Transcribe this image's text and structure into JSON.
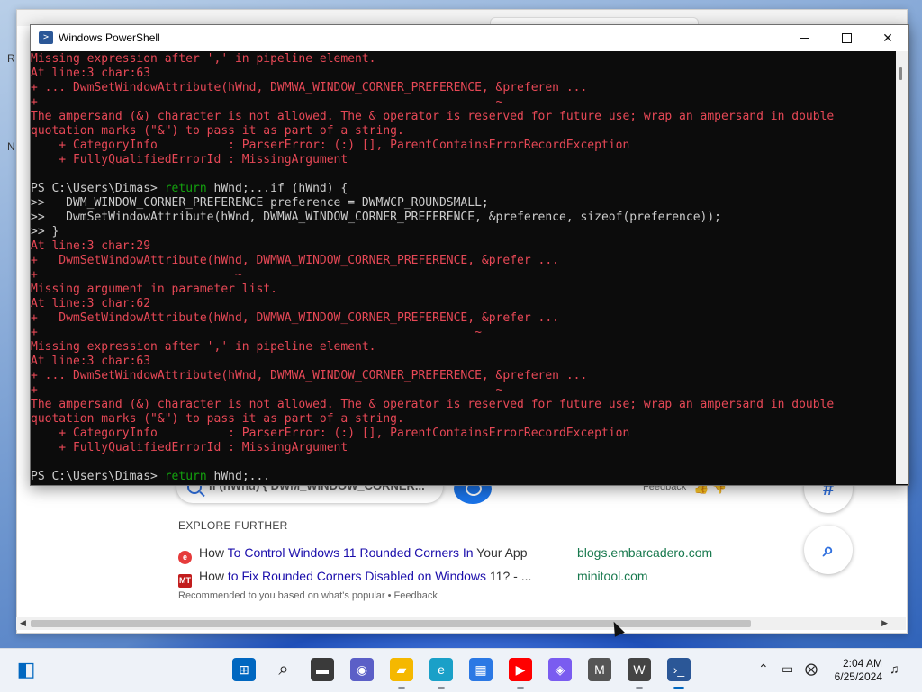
{
  "desktop": {
    "left_strip_letters": [
      "R",
      "N"
    ]
  },
  "browser": {
    "search_query": "if (hWnd) {   DWM_WINDOW_CORNER...",
    "feedback_label": "Feedback",
    "side_buttons": [
      {
        "glyph": "#"
      },
      {
        "glyph": "⌕"
      }
    ],
    "explore_title": "EXPLORE FURTHER",
    "results": [
      {
        "favicon_text": "e",
        "favicon_color": "#e63b3b",
        "pre": "How ",
        "link": "To Control Windows 11 Rounded Corners In",
        "post": " Your App",
        "source": "blogs.embarcadero.com"
      },
      {
        "favicon_text": "MT",
        "favicon_color": "#c21d1d",
        "pre": "How ",
        "link": "to Fix Rounded Corners Disabled on Windows",
        "post": " 11? - ...",
        "source": "minitool.com"
      }
    ],
    "recommended_text": "Recommended to you based on what's popular • Feedback"
  },
  "powershell": {
    "title": "Windows PowerShell",
    "lines": [
      {
        "cls": "err",
        "text": "Missing expression after ',' in pipeline element."
      },
      {
        "cls": "err",
        "text": "At line:3 char:63"
      },
      {
        "cls": "err",
        "text": "+ ... DwmSetWindowAttribute(hWnd, DWMWA_WINDOW_CORNER_PREFERENCE, &preferen ..."
      },
      {
        "cls": "err",
        "text": "+                                                                 ~"
      },
      {
        "cls": "err",
        "text": "The ampersand (&) character is not allowed. The & operator is reserved for future use; wrap an ampersand in double"
      },
      {
        "cls": "err",
        "text": "quotation marks (\"&\") to pass it as part of a string."
      },
      {
        "cls": "err",
        "text": "    + CategoryInfo          : ParserError: (:) [], ParentContainsErrorRecordException"
      },
      {
        "cls": "err",
        "text": "    + FullyQualifiedErrorId : MissingArgument"
      },
      {
        "cls": "",
        "text": " "
      },
      {
        "cls": "",
        "prompt": "PS C:\\Users\\Dimas> ",
        "kw": "return",
        "text": " hWnd;...if (hWnd) {"
      },
      {
        "cls": "",
        "text": ">>   DWM_WINDOW_CORNER_PREFERENCE preference = DWMWCP_ROUNDSMALL;"
      },
      {
        "cls": "",
        "text": ">>   DwmSetWindowAttribute(hWnd, DWMWA_WINDOW_CORNER_PREFERENCE, &preference, sizeof(preference));"
      },
      {
        "cls": "",
        "text": ">> }"
      },
      {
        "cls": "err",
        "text": "At line:3 char:29"
      },
      {
        "cls": "err",
        "text": "+   DwmSetWindowAttribute(hWnd, DWMWA_WINDOW_CORNER_PREFERENCE, &prefer ..."
      },
      {
        "cls": "err",
        "text": "+                            ~"
      },
      {
        "cls": "err",
        "text": "Missing argument in parameter list."
      },
      {
        "cls": "err",
        "text": "At line:3 char:62"
      },
      {
        "cls": "err",
        "text": "+   DwmSetWindowAttribute(hWnd, DWMWA_WINDOW_CORNER_PREFERENCE, &prefer ..."
      },
      {
        "cls": "err",
        "text": "+                                                              ~"
      },
      {
        "cls": "err",
        "text": "Missing expression after ',' in pipeline element."
      },
      {
        "cls": "err",
        "text": "At line:3 char:63"
      },
      {
        "cls": "err",
        "text": "+ ... DwmSetWindowAttribute(hWnd, DWMWA_WINDOW_CORNER_PREFERENCE, &preferen ..."
      },
      {
        "cls": "err",
        "text": "+                                                                 ~"
      },
      {
        "cls": "err",
        "text": "The ampersand (&) character is not allowed. The & operator is reserved for future use; wrap an ampersand in double"
      },
      {
        "cls": "err",
        "text": "quotation marks (\"&\") to pass it as part of a string."
      },
      {
        "cls": "err",
        "text": "    + CategoryInfo          : ParserError: (:) [], ParentContainsErrorRecordException"
      },
      {
        "cls": "err",
        "text": "    + FullyQualifiedErrorId : MissingArgument"
      },
      {
        "cls": "",
        "text": " "
      },
      {
        "cls": "",
        "prompt": "PS C:\\Users\\Dimas> ",
        "kw": "return",
        "text": " hWnd;..."
      }
    ]
  },
  "taskbar": {
    "apps": [
      {
        "name": "start-icon",
        "glyph": "⊞",
        "bg": "#0067c0"
      },
      {
        "name": "search-icon",
        "glyph": "⌕",
        "bg": "transparent"
      },
      {
        "name": "task-view-icon",
        "glyph": "▬",
        "bg": "#3a3a3a"
      },
      {
        "name": "meet-icon",
        "glyph": "◉",
        "bg": "#5b5fc7"
      },
      {
        "name": "file-explorer-icon",
        "glyph": "▰",
        "bg": "#f5b800"
      },
      {
        "name": "edge-icon",
        "glyph": "e",
        "bg": "#1aa0c8"
      },
      {
        "name": "store-icon",
        "glyph": "▦",
        "bg": "#2b78e4"
      },
      {
        "name": "youtube-icon",
        "glyph": "▶",
        "bg": "#ff0000"
      },
      {
        "name": "copilot-icon",
        "glyph": "◈",
        "bg": "#7a5cf0"
      },
      {
        "name": "m-app-icon",
        "glyph": "M",
        "bg": "#555555"
      },
      {
        "name": "wikipedia-icon",
        "glyph": "W",
        "bg": "#444444"
      },
      {
        "name": "powershell-icon",
        "glyph": "›_",
        "bg": "#2b5797"
      }
    ],
    "time": "2:04 AM",
    "date": "6/25/2024"
  }
}
